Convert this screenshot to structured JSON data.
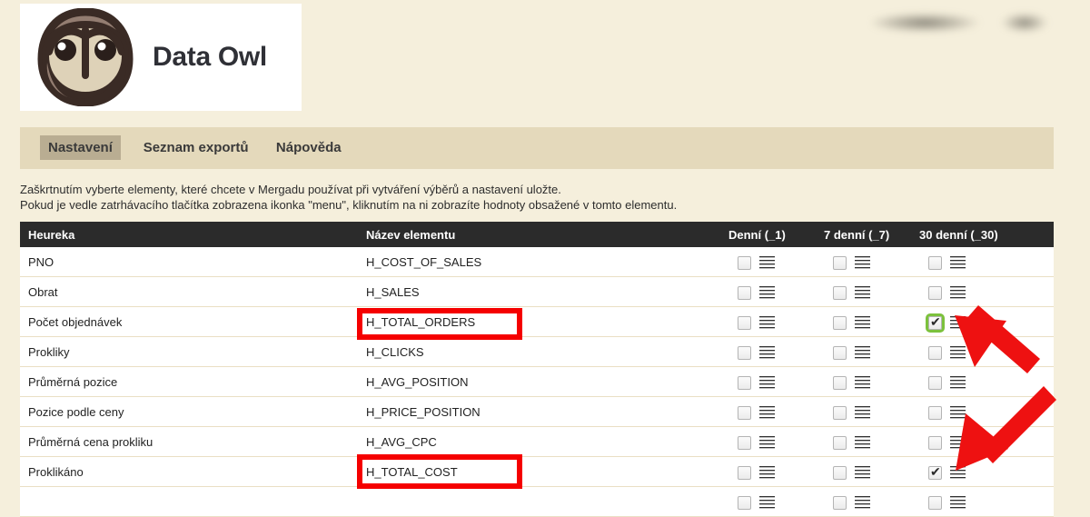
{
  "header": {
    "logo_alt": "owl-logo",
    "brand": "Data Owl",
    "account_redacted": ""
  },
  "nav": {
    "tabs": [
      {
        "label": "Nastavení",
        "active": true
      },
      {
        "label": "Seznam exportů",
        "active": false
      },
      {
        "label": "Nápověda",
        "active": false
      }
    ]
  },
  "instructions": {
    "line1": "Zaškrtnutím vyberte elementy, které chcete v Mergadu používat při vytváření výběrů a nastavení uložte.",
    "line2": "Pokud je vedle zatrhávacího tlačítka zobrazena ikonka \"menu\", kliknutím na ni zobrazíte hodnoty obsažené v tomto elementu."
  },
  "table": {
    "headers": {
      "name": "Heureka",
      "element": "Název elementu",
      "daily": "Denní (_1)",
      "weekly": "7 denní (_7)",
      "monthly": "30 denní (_30)"
    },
    "rows": [
      {
        "label": "PNO",
        "element": "H_COST_OF_SALES",
        "daily": false,
        "weekly": false,
        "monthly": false,
        "highlight_element": false,
        "highlight_monthly": false
      },
      {
        "label": "Obrat",
        "element": "H_SALES",
        "daily": false,
        "weekly": false,
        "monthly": false,
        "highlight_element": false,
        "highlight_monthly": false
      },
      {
        "label": "Počet objednávek",
        "element": "H_TOTAL_ORDERS",
        "daily": false,
        "weekly": false,
        "monthly": true,
        "highlight_element": true,
        "highlight_monthly": true
      },
      {
        "label": "Prokliky",
        "element": "H_CLICKS",
        "daily": false,
        "weekly": false,
        "monthly": false,
        "highlight_element": false,
        "highlight_monthly": false
      },
      {
        "label": "Průměrná pozice",
        "element": "H_AVG_POSITION",
        "daily": false,
        "weekly": false,
        "monthly": false,
        "highlight_element": false,
        "highlight_monthly": false
      },
      {
        "label": "Pozice podle ceny",
        "element": "H_PRICE_POSITION",
        "daily": false,
        "weekly": false,
        "monthly": false,
        "highlight_element": false,
        "highlight_monthly": false
      },
      {
        "label": "Průměrná cena prokliku",
        "element": "H_AVG_CPC",
        "daily": false,
        "weekly": false,
        "monthly": false,
        "highlight_element": false,
        "highlight_monthly": false
      },
      {
        "label": "Proklikáno",
        "element": "H_TOTAL_COST",
        "daily": false,
        "weekly": false,
        "monthly": true,
        "highlight_element": true,
        "highlight_monthly": false
      },
      {
        "label": "",
        "element": "",
        "daily": false,
        "weekly": false,
        "monthly": false,
        "highlight_element": false,
        "highlight_monthly": false
      }
    ]
  },
  "colors": {
    "page_bg": "#f5efdc",
    "nav_bg": "#e4d9bb",
    "tab_active_bg": "#b9ad92",
    "table_header_bg": "#2b2b2b",
    "row_bg": "#ffffff",
    "row_divider": "#eadfc4",
    "annotation_red": "#f50000",
    "checkbox_highlight_green": "#7cc13c",
    "owl_outline": "#3a2b25",
    "owl_body": "#937d71",
    "owl_face": "#ded2b8"
  },
  "annotations": {
    "arrow_count": 2,
    "redbox_count": 2,
    "icons": {
      "checkbox": "checkbox-icon",
      "menu": "hamburger-menu-icon",
      "arrow": "red-arrow-icon"
    }
  }
}
